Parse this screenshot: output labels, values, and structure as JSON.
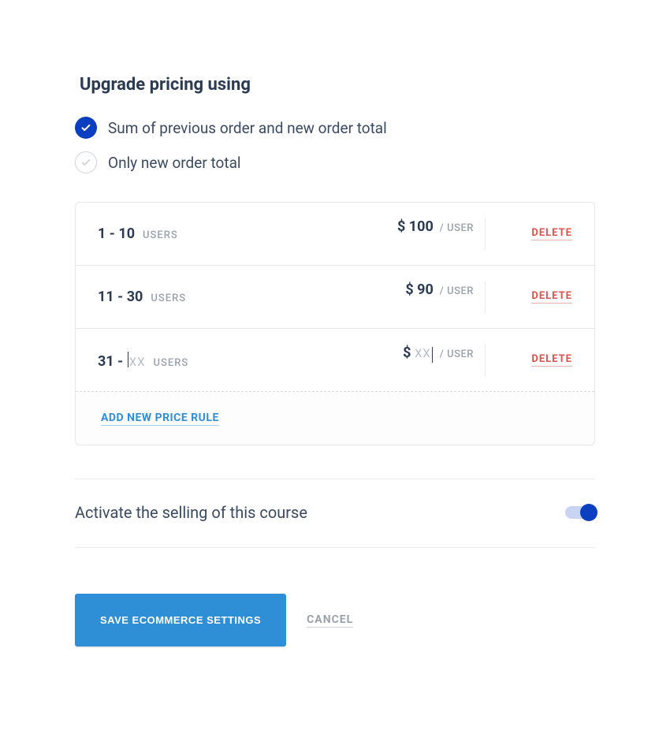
{
  "section_title": "Upgrade pricing using",
  "radio": {
    "sum_label": "Sum of previous order and new order total",
    "new_label": "Only new order total",
    "selected": "sum"
  },
  "rows": [
    {
      "range": "1 - 10",
      "users_label": "USERS",
      "currency": "$",
      "amount": "100",
      "per": "/ USER",
      "delete_label": "DELETE",
      "editing": false
    },
    {
      "range": "11 - 30",
      "users_label": "USERS",
      "currency": "$",
      "amount": "90",
      "per": "/ USER",
      "delete_label": "DELETE",
      "editing": false
    },
    {
      "range_prefix": "31 -",
      "range_placeholder": "XX",
      "users_label": "USERS",
      "currency": "$",
      "amount_placeholder": "XX",
      "per": "/ USER",
      "delete_label": "DELETE",
      "editing": true
    }
  ],
  "add_rule_label": "ADD NEW PRICE RULE",
  "toggle": {
    "label": "Activate the selling of this course",
    "on": true
  },
  "actions": {
    "save_label": "SAVE ECOMMERCE SETTINGS",
    "cancel_label": "CANCEL"
  }
}
